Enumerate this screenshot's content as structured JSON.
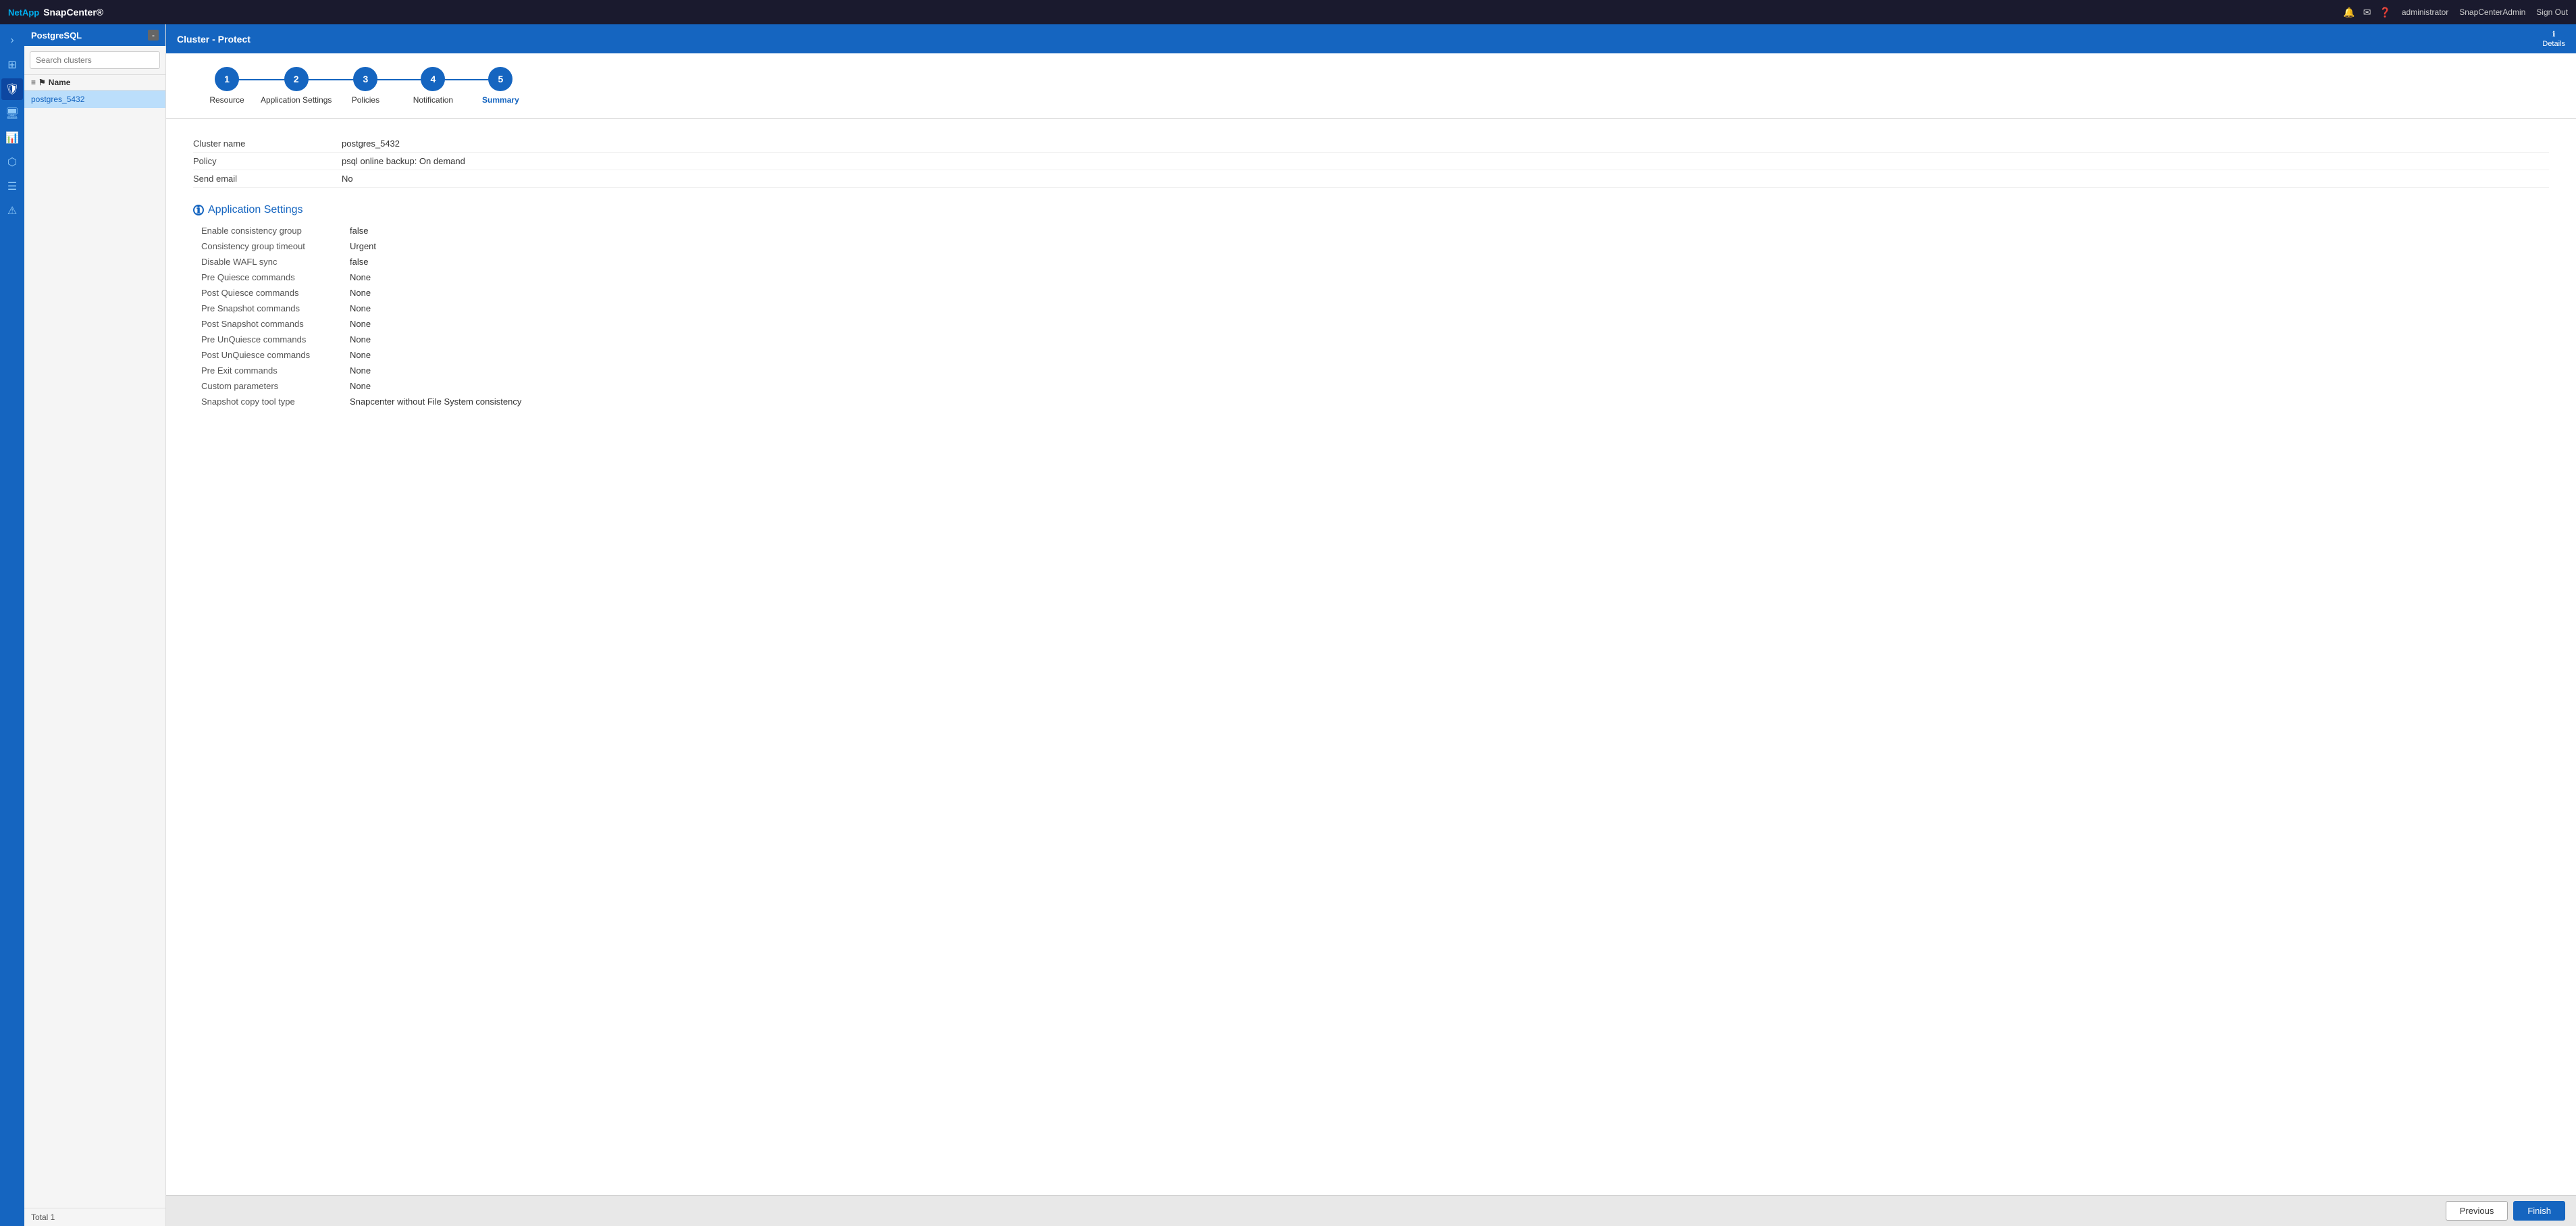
{
  "topbar": {
    "brand": "NetApp",
    "app": "SnapCenter®",
    "icons": [
      "bell",
      "mail",
      "question",
      "user",
      "admin"
    ],
    "user_label": "administrator",
    "admin_label": "SnapCenterAdmin",
    "signout_label": "Sign Out"
  },
  "sidebar": {
    "db_label": "PostgreSQL",
    "btn_label": "-",
    "search_placeholder": "Search clusters",
    "col_header": "Name",
    "items": [
      {
        "name": "postgres_5432",
        "selected": true
      }
    ],
    "footer": "Total 1"
  },
  "content_header": {
    "title": "Cluster - Protect",
    "details_label": "Details"
  },
  "wizard": {
    "steps": [
      {
        "number": "1",
        "label": "Resource",
        "active": false
      },
      {
        "number": "2",
        "label": "Application Settings",
        "active": false
      },
      {
        "number": "3",
        "label": "Policies",
        "active": false
      },
      {
        "number": "4",
        "label": "Notification",
        "active": false
      },
      {
        "number": "5",
        "label": "Summary",
        "active": true
      }
    ]
  },
  "summary": {
    "cluster_name_label": "Cluster name",
    "cluster_name_value": "postgres_5432",
    "policy_label": "Policy",
    "policy_value": "psql online backup: On demand",
    "send_email_label": "Send email",
    "send_email_value": "No",
    "app_settings_label": "Application Settings",
    "app_settings_icon": "ⓘ",
    "fields": [
      {
        "label": "Enable consistency group",
        "value": "false"
      },
      {
        "label": "Consistency group timeout",
        "value": "Urgent"
      },
      {
        "label": "Disable WAFL sync",
        "value": "false"
      },
      {
        "label": "Pre Quiesce commands",
        "value": "None"
      },
      {
        "label": "Post Quiesce commands",
        "value": "None"
      },
      {
        "label": "Pre Snapshot commands",
        "value": "None"
      },
      {
        "label": "Post Snapshot commands",
        "value": "None"
      },
      {
        "label": "Pre UnQuiesce commands",
        "value": "None"
      },
      {
        "label": "Post UnQuiesce commands",
        "value": "None"
      },
      {
        "label": "Pre Exit commands",
        "value": "None"
      },
      {
        "label": "Custom parameters",
        "value": "None"
      },
      {
        "label": "Snapshot copy tool type",
        "value": "Snapcenter without File System consistency"
      }
    ]
  },
  "footer": {
    "previous_label": "Previous",
    "finish_label": "Finish"
  }
}
